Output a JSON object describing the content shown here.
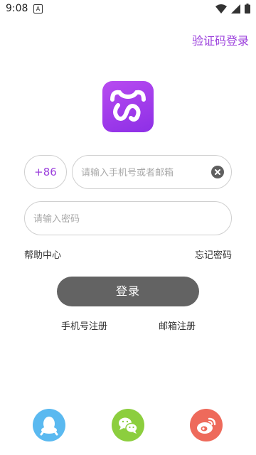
{
  "status_bar": {
    "time": "9:08",
    "notification_glyph": "A"
  },
  "header": {
    "sms_login_link": "验证码登录"
  },
  "brand": {
    "accent_color": "#9b3fdc",
    "logo": "app-logo-icon"
  },
  "form": {
    "country_code": "+86",
    "phone_placeholder": "请输入手机号或者邮箱",
    "phone_value": "",
    "password_placeholder": "请输入密码",
    "password_value": ""
  },
  "links": {
    "help": "帮助中心",
    "forgot_password": "忘记密码"
  },
  "login_button": "登录",
  "register": {
    "phone": "手机号注册",
    "email": "邮箱注册"
  },
  "social_login": [
    {
      "icon": "qq-icon",
      "color": "#5ab9f0"
    },
    {
      "icon": "wechat-icon",
      "color": "#8cce3e"
    },
    {
      "icon": "weibo-icon",
      "color": "#ee6a5b"
    }
  ]
}
